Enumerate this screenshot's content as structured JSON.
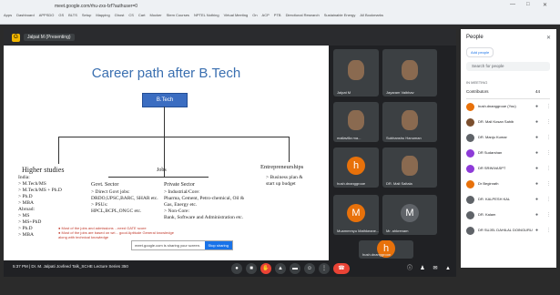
{
  "browser": {
    "url": "meet.google.com/rhu-zxs-fzf?authuser=0",
    "bookmarks": [
      "Apps",
      "Dashboard",
      "APPSDO",
      "GS",
      "BLTS",
      "Setup",
      "Mapping",
      "Ghost",
      "CS",
      "Cart",
      "Mocker",
      "Stem Courses",
      "NPTEL Nothing",
      "Virtual Meeting",
      "On",
      "ACP",
      "PTB",
      "Directional Research",
      "Sustainable Energy",
      "All Bookmarks"
    ]
  },
  "meeting": {
    "logo": "G",
    "name": "Jalpat M (Presenting)",
    "bottom_left": "5:37 PM | Dr. M. Jalpati Jovfeed Talk_SCHE Lecture Series 350",
    "controls": [
      "mic-off",
      "cam",
      "raise",
      "present",
      "cc",
      "more",
      "end"
    ]
  },
  "slide": {
    "title": "Career path after B.Tech",
    "root": "B.Tech",
    "higher_studies": {
      "title": "Higher studies",
      "body": "India:\n> M.Tech/MS\n> M.Tech/MS + Ph.D\n> Ph.D\n> MBA\nAbroad:\n> MS\n> MS+PhD\n> Ph.D\n> MBA"
    },
    "jobs": {
      "title": "Jobs",
      "govt_title": "Govt. Sector",
      "govt_body": "> Direct Govt jobs:\n  DRDO,UPSC,BARC, SHAR etc.\n> PSUs:\n  HPCL,BCPL,ONGC etc.",
      "private_title": "Private Sector",
      "private_body": "> Industrial/Core:\n  Pharma, Cement, Petro-chemical, Oil &\n  Gas, Energy etc.\n> Non-Core:\n  Bank, Software and Administration etc."
    },
    "entre": {
      "title": "Entrepreneurships",
      "body": "> Business plan &\n  start up budget"
    },
    "notes": "● Most of the jobs and admissions ...need GATE score\n● Most of the jobs are based on wri... good Aptitude General knowledge\n   along with technical knowledge",
    "share_notice": "meet.google.com is sharing your screen.",
    "share_button": "Stop sharing"
  },
  "tiles": [
    {
      "name": "Jalpat M",
      "kind": "photo"
    },
    {
      "name": "Jayaram Vaibhav",
      "kind": "photo"
    },
    {
      "name": "mallavilla ma...",
      "kind": "photo"
    },
    {
      "name": "Subhanshu Hanuman",
      "kind": "photo"
    },
    {
      "name": "hush.dnanggrooe",
      "kind": "avatar",
      "letter": "h",
      "color": "#e8710a"
    },
    {
      "name": "DR. Mali Saltala",
      "kind": "photo"
    },
    {
      "name": "Muammmyu Mathkeane...",
      "kind": "avatar",
      "letter": "M",
      "color": "#e8710a"
    },
    {
      "name": "Mr. ahkrenam",
      "kind": "avatar2",
      "letter": "M",
      "color": "#5f6368"
    },
    {
      "name": "hush.dnanggrooe",
      "kind": "avatar",
      "letter": "h",
      "color": "#e8710a"
    }
  ],
  "people": {
    "title": "People",
    "add_label": "Add people",
    "search_placeholder": "Search for people",
    "section": "IN MEETING",
    "contributors_label": "Contributors",
    "contributors_count": "44",
    "list": [
      {
        "name": "hush.dnanggrooe (You)",
        "color": "#e8710a"
      },
      {
        "name": "DR. Mali Kosan Sahib",
        "color": "#7b4f2e"
      },
      {
        "name": "DR. Manju Kumar",
        "color": "#5f6368"
      },
      {
        "name": "DR Sudarshan",
        "color": "#8e3bd8"
      },
      {
        "name": "DR SRINIVASPT",
        "color": "#8e3bd8"
      },
      {
        "name": "Dr Beginrath",
        "color": "#e8710a"
      },
      {
        "name": "DR. KALPESH KAL",
        "color": "#5f6368"
      },
      {
        "name": "DR. Kalam",
        "color": "#5f6368"
      },
      {
        "name": "DR SUJEL DAHILAL DOINGURU",
        "color": "#5f6368"
      }
    ]
  }
}
